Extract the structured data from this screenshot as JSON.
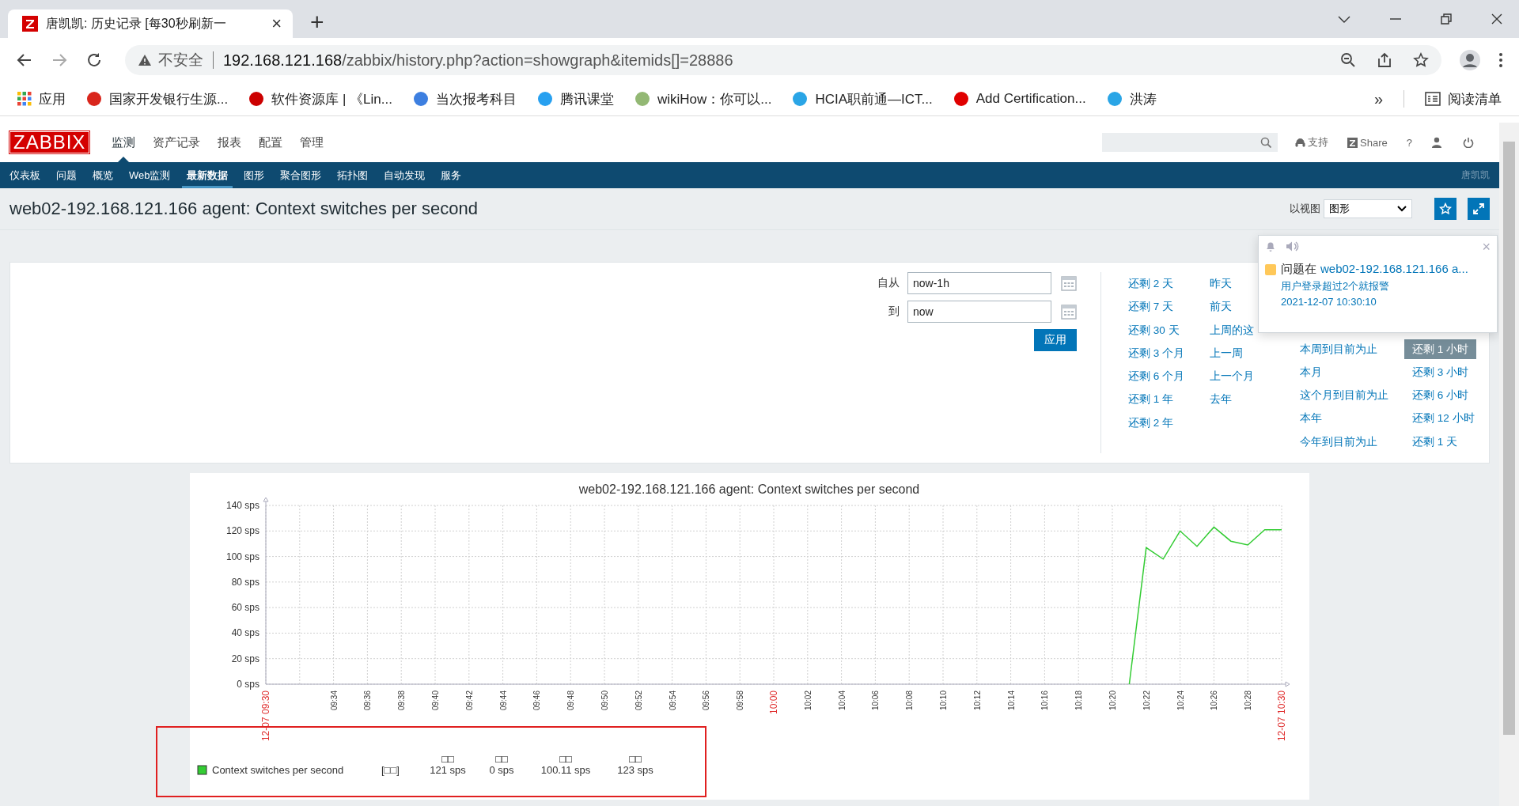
{
  "browser": {
    "tab": {
      "title": "唐凯凯: 历史记录 [每30秒刷新一",
      "close": "×"
    },
    "new_tab": "+",
    "security": "不安全",
    "url_host": "192.168.121.168",
    "url_path": "/zabbix/history.php?action=showgraph&itemids[]=28886",
    "bookmarks": [
      {
        "label": "应用",
        "kind": "apps"
      },
      {
        "label": "国家开发银行生源...",
        "kind": "site",
        "color": "#d9261c"
      },
      {
        "label": "软件资源库 | 《Lin...",
        "kind": "site",
        "color": "#cc0000"
      },
      {
        "label": "当次报考科目",
        "kind": "site",
        "color": "#3d7fe0"
      },
      {
        "label": "腾讯课堂",
        "kind": "site",
        "color": "#27a0f0"
      },
      {
        "label": "wikiHow：你可以...",
        "kind": "site",
        "color": "#93b874"
      },
      {
        "label": "HCIA职前通—ICT...",
        "kind": "site",
        "color": "#2aa5e6"
      },
      {
        "label": "Add Certification...",
        "kind": "site",
        "color": "#e00000"
      },
      {
        "label": "洪涛",
        "kind": "site",
        "color": "#2aa5e6"
      }
    ],
    "more": "»",
    "reading_list": "阅读清单"
  },
  "header": {
    "logo": "ZABBIX",
    "menu": [
      {
        "label": "监测",
        "selected": true
      },
      {
        "label": "资产记录",
        "selected": false
      },
      {
        "label": "报表",
        "selected": false
      },
      {
        "label": "配置",
        "selected": false
      },
      {
        "label": "管理",
        "selected": false
      }
    ],
    "support": "支持",
    "share": "Share",
    "help": "?"
  },
  "subnav": {
    "items": [
      {
        "label": "仪表板",
        "selected": false
      },
      {
        "label": "问题",
        "selected": false
      },
      {
        "label": "概览",
        "selected": false
      },
      {
        "label": "Web监测",
        "selected": false
      },
      {
        "label": "最新数据",
        "selected": true
      },
      {
        "label": "图形",
        "selected": false
      },
      {
        "label": "聚合图形",
        "selected": false
      },
      {
        "label": "拓扑图",
        "selected": false
      },
      {
        "label": "自动发现",
        "selected": false
      },
      {
        "label": "服务",
        "selected": false
      }
    ],
    "user": "唐凯凯"
  },
  "page": {
    "title": "web02-192.168.121.166 agent: Context switches per second",
    "view_label": "以视图",
    "view_value": "图形"
  },
  "filter": {
    "from_label": "自从",
    "from": "now-1h",
    "to_label": "到",
    "to": "now",
    "apply": "应用",
    "columns": [
      [
        {
          "label": "还剩 2 天",
          "selected": false
        },
        {
          "label": "还剩 7 天",
          "selected": false
        },
        {
          "label": "还剩 30 天",
          "selected": false
        },
        {
          "label": "还剩 3 个月",
          "selected": false
        },
        {
          "label": "还剩 6 个月",
          "selected": false
        },
        {
          "label": "还剩 1 年",
          "selected": false
        },
        {
          "label": "还剩 2 年",
          "selected": false
        }
      ],
      [
        {
          "label": "昨天",
          "selected": false
        },
        {
          "label": "前天",
          "selected": false
        },
        {
          "label": "上周的这",
          "selected": false
        },
        {
          "label": "上一周",
          "selected": false
        },
        {
          "label": "上一个月",
          "selected": false
        },
        {
          "label": "去年",
          "selected": false
        }
      ],
      [
        {
          "label": "本周到目前为止",
          "selected": false
        },
        {
          "label": "本月",
          "selected": false
        },
        {
          "label": "这个月到目前为止",
          "selected": false
        },
        {
          "label": "本年",
          "selected": false
        },
        {
          "label": "今年到目前为止",
          "selected": false
        }
      ],
      [
        {
          "label": "还剩 1 小时",
          "selected": true
        },
        {
          "label": "还剩 3 小时",
          "selected": false
        },
        {
          "label": "还剩 6 小时",
          "selected": false
        },
        {
          "label": "还剩 12 小时",
          "selected": false
        },
        {
          "label": "还剩 1 天",
          "selected": false
        }
      ]
    ]
  },
  "notification": {
    "close": "×",
    "items": [
      {
        "prefix": "问题在",
        "host": "web02-192.168.121.166 a...",
        "problem": "用户登录超过2个就报警",
        "time": "2021-12-07 10:30:10",
        "color": "#ffc859"
      }
    ]
  },
  "graph": {
    "chart_data": {
      "type": "line",
      "title": "web02-192.168.121.166 agent: Context switches per second",
      "categories": [
        "12-07 09:30",
        null,
        null,
        null,
        "09:34",
        null,
        "09:36",
        null,
        "09:38",
        null,
        "09:40",
        null,
        "09:42",
        null,
        "09:44",
        null,
        "09:46",
        null,
        "09:48",
        null,
        "09:50",
        null,
        "09:52",
        null,
        "09:54",
        null,
        "09:56",
        null,
        "09:58",
        null,
        "10:00",
        null,
        "10:02",
        null,
        "10:04",
        null,
        "10:06",
        null,
        "10:08",
        null,
        "10:10",
        null,
        "10:12",
        null,
        "10:14",
        null,
        "10:16",
        null,
        "10:18",
        null,
        "10:20",
        null,
        "10:22",
        null,
        "10:24",
        null,
        "10:26",
        null,
        "10:28",
        null,
        "12-07 10:30"
      ],
      "series": [
        {
          "name": "Context switches per second",
          "color": "#33cc33",
          "values": [
            null,
            null,
            null,
            null,
            null,
            null,
            null,
            null,
            null,
            null,
            null,
            null,
            null,
            null,
            null,
            null,
            null,
            null,
            null,
            null,
            null,
            null,
            null,
            null,
            null,
            null,
            null,
            null,
            null,
            null,
            null,
            null,
            null,
            null,
            null,
            null,
            null,
            null,
            null,
            null,
            null,
            null,
            null,
            null,
            null,
            null,
            null,
            null,
            null,
            null,
            null,
            0,
            107,
            98,
            120,
            108,
            123,
            112,
            109,
            121,
            121
          ]
        }
      ],
      "ylim": [
        0,
        140
      ],
      "grid": true,
      "yticks": [
        {
          "value": 0,
          "label": "0 sps"
        },
        {
          "value": 20,
          "label": "20 sps"
        },
        {
          "value": 40,
          "label": "40 sps"
        },
        {
          "value": 60,
          "label": "60 sps"
        },
        {
          "value": 80,
          "label": "80 sps"
        },
        {
          "value": 100,
          "label": "100 sps"
        },
        {
          "value": 120,
          "label": "120 sps"
        },
        {
          "value": 140,
          "label": "140 sps"
        }
      ]
    },
    "legend": {
      "function": "[□□]",
      "stats": [
        {
          "header": "□□",
          "value": "121 sps"
        },
        {
          "header": "□□",
          "value": "0 sps"
        },
        {
          "header": "□□",
          "value": "100.11 sps"
        },
        {
          "header": "□□",
          "value": "123 sps"
        }
      ]
    }
  }
}
